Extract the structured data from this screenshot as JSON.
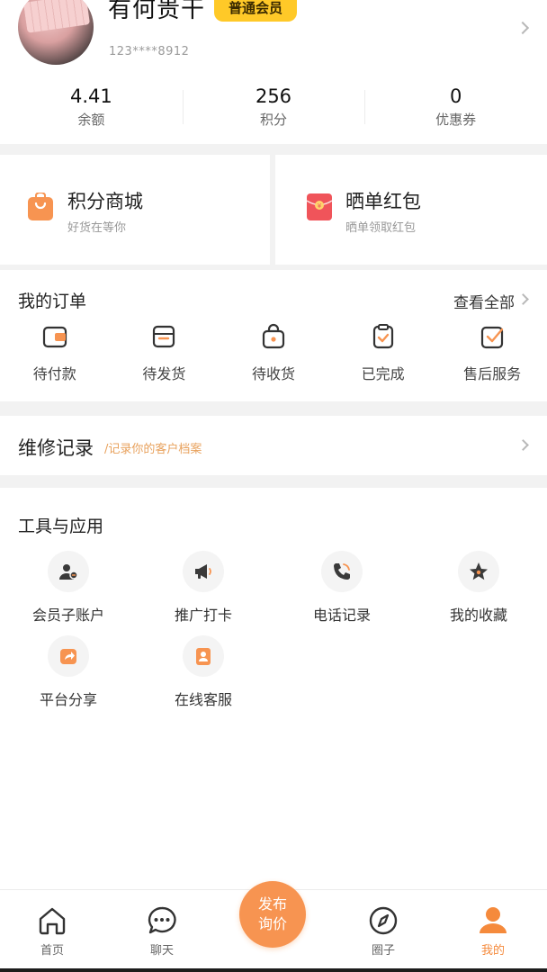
{
  "profile": {
    "username": "有何贵干",
    "member_level": "普通会员",
    "phone": "123****8912"
  },
  "stats": [
    {
      "value": "4.41",
      "label": "余额"
    },
    {
      "value": "256",
      "label": "积分"
    },
    {
      "value": "0",
      "label": "优惠券"
    }
  ],
  "promos": [
    {
      "title": "积分商城",
      "subtitle": "好货在等你",
      "icon": "shopping-bag-icon",
      "color": "#f79451"
    },
    {
      "title": "晒单红包",
      "subtitle": "晒单领取红包",
      "icon": "red-envelope-icon",
      "color": "#f0545a"
    }
  ],
  "orders": {
    "title": "我的订单",
    "view_all": "查看全部",
    "items": [
      {
        "label": "待付款",
        "icon": "wallet-icon"
      },
      {
        "label": "待发货",
        "icon": "package-icon"
      },
      {
        "label": "待收货",
        "icon": "bag-icon"
      },
      {
        "label": "已完成",
        "icon": "clipboard-check-icon"
      },
      {
        "label": "售后服务",
        "icon": "checkbox-icon"
      }
    ]
  },
  "repair": {
    "title": "维修记录",
    "subtitle": "/记录你的客户档案"
  },
  "tools": {
    "title": "工具与应用",
    "items": [
      {
        "label": "会员子账户",
        "icon": "user-account-icon"
      },
      {
        "label": "推广打卡",
        "icon": "megaphone-icon"
      },
      {
        "label": "电话记录",
        "icon": "phone-icon"
      },
      {
        "label": "我的收藏",
        "icon": "star-icon"
      },
      {
        "label": "平台分享",
        "icon": "share-icon"
      },
      {
        "label": "在线客服",
        "icon": "customer-service-icon"
      }
    ]
  },
  "tabbar": {
    "items": [
      {
        "label": "首页",
        "icon": "home-icon"
      },
      {
        "label": "聊天",
        "icon": "chat-icon"
      },
      {
        "label": "圈子",
        "icon": "compass-icon"
      },
      {
        "label": "我的",
        "icon": "profile-icon",
        "active": true
      }
    ],
    "publish_line1": "发布",
    "publish_line2": "询价"
  },
  "colors": {
    "accent": "#f58a3c",
    "badge": "#ffc928",
    "icon_gray": "#3a3a3a"
  }
}
